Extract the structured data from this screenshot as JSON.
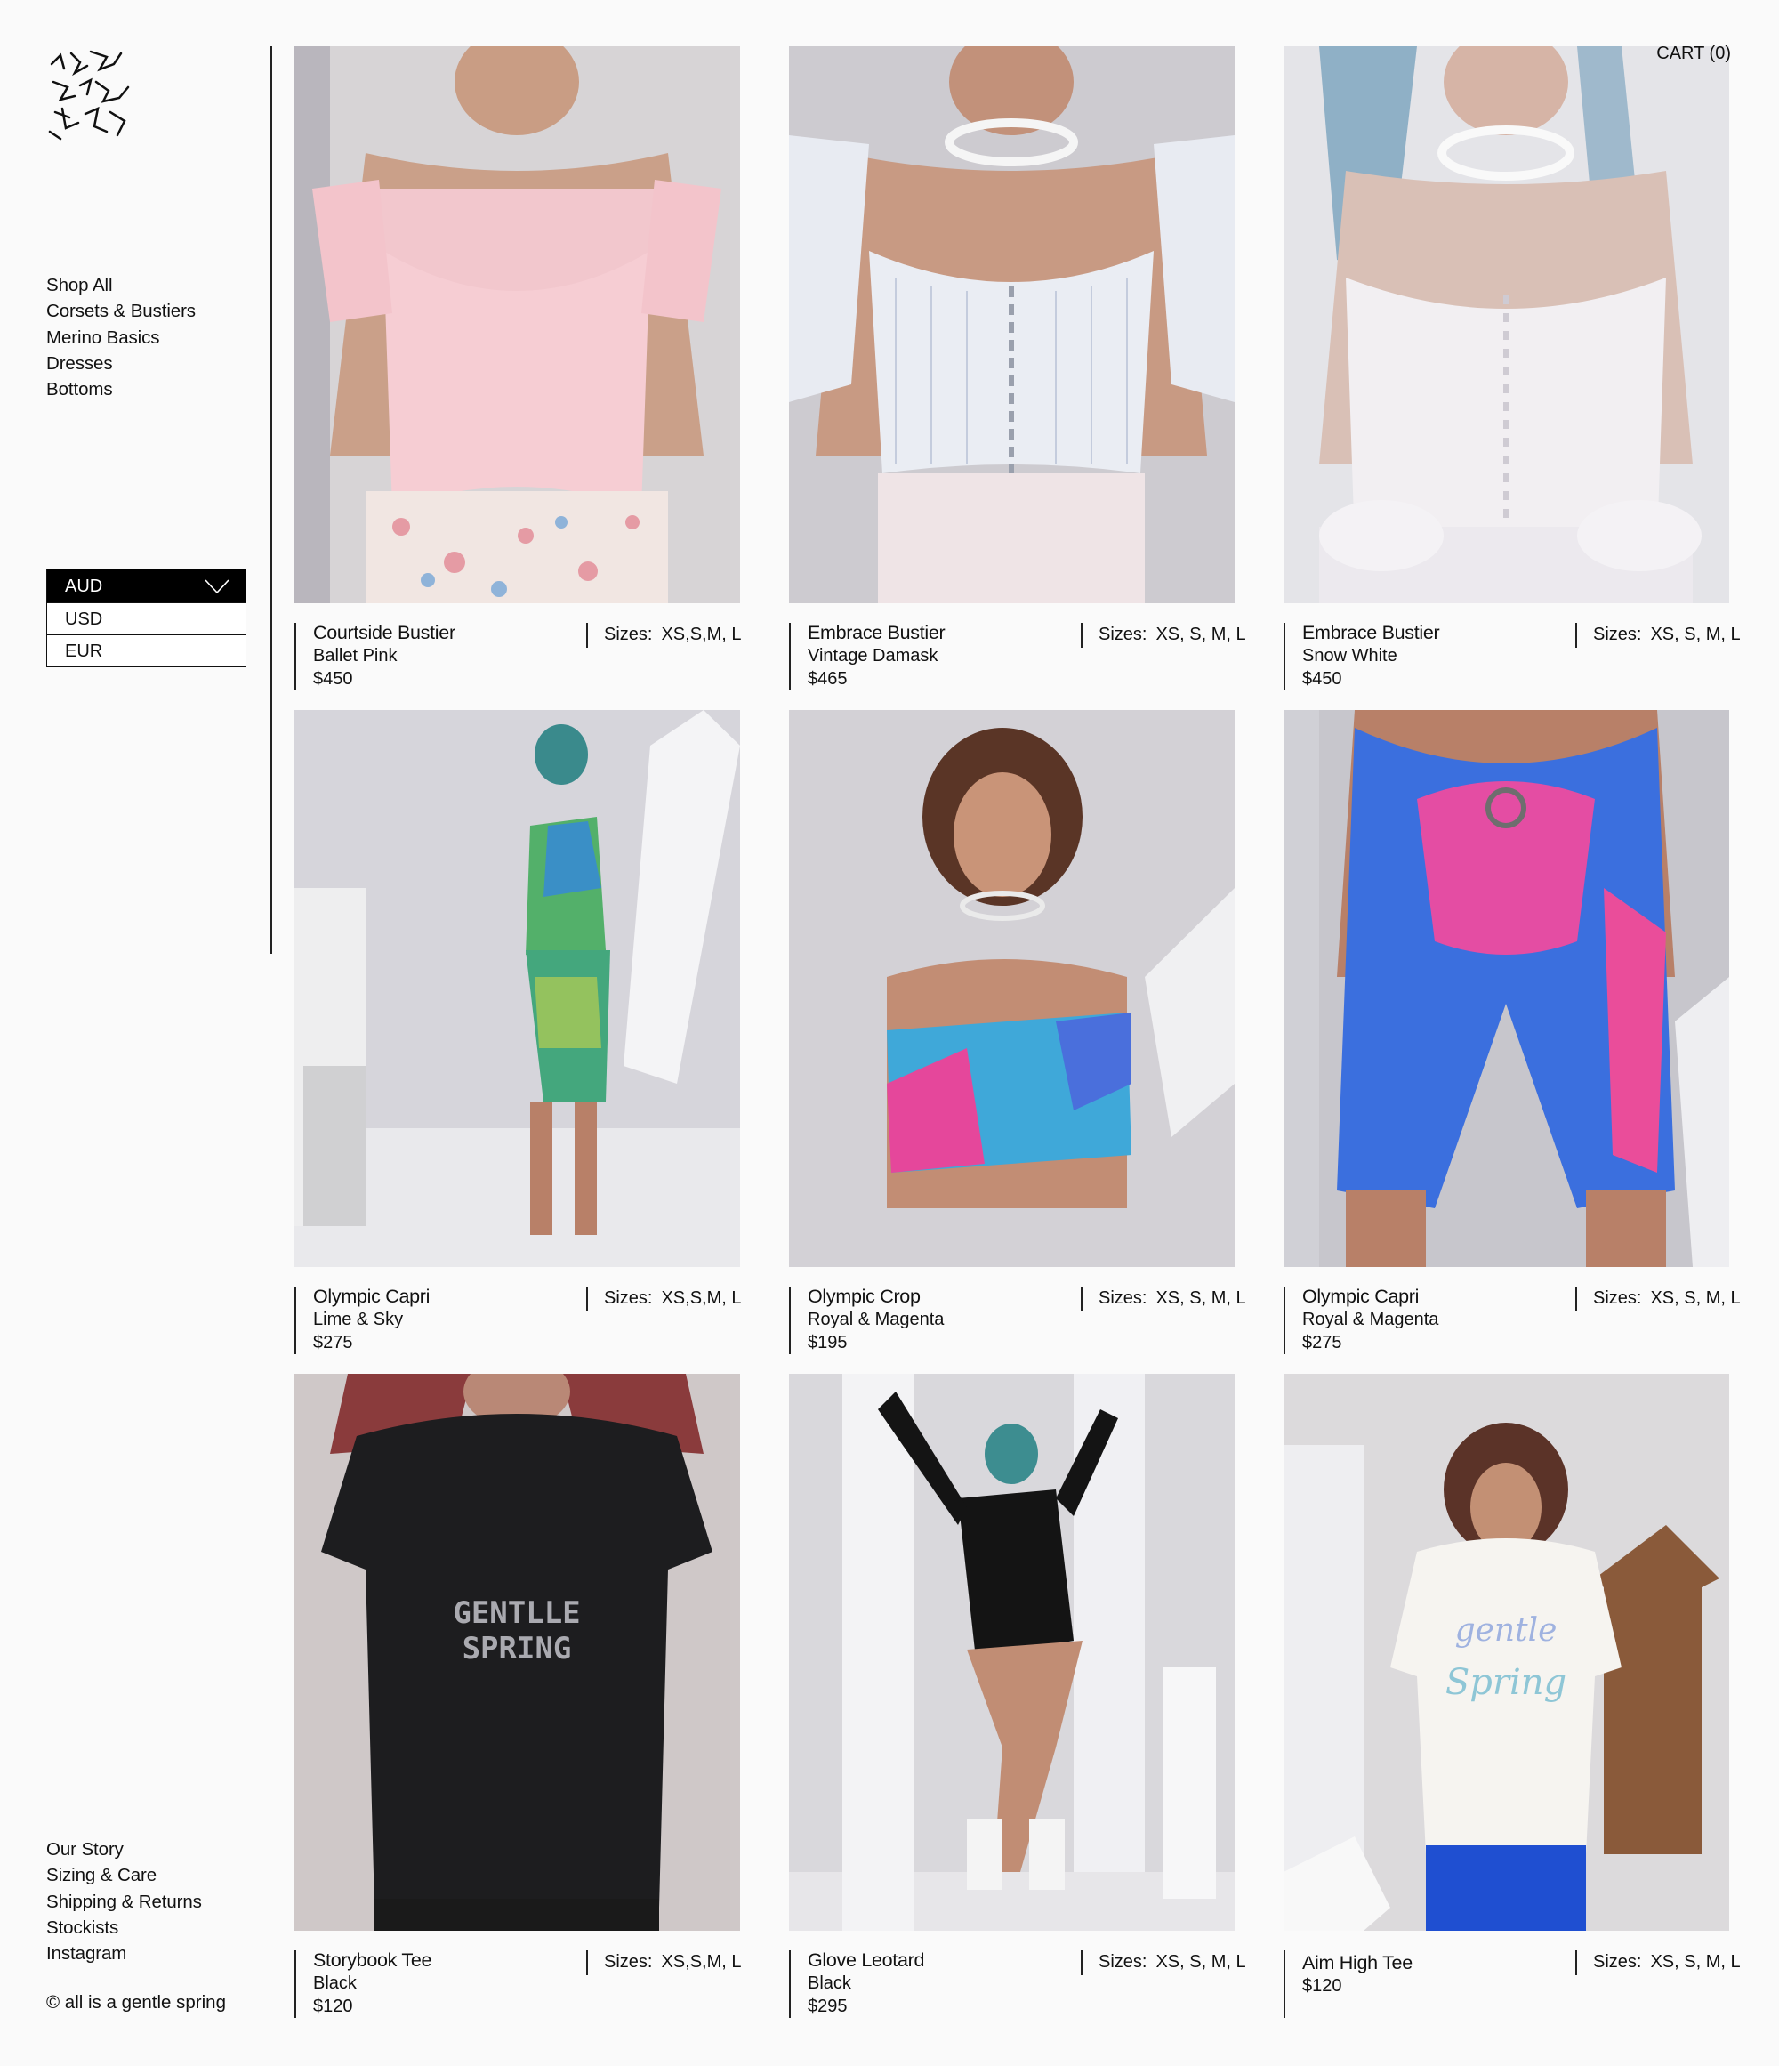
{
  "cart_label": "CART (0)",
  "nav": [
    "Shop All",
    "Corsets & Bustiers",
    "Merino Basics",
    "Dresses",
    "Bottoms"
  ],
  "currency": {
    "selected": "AUD",
    "options": [
      "USD",
      "EUR"
    ]
  },
  "footer_nav": [
    "Our Story",
    "Sizing & Care",
    "Shipping & Returns",
    "Stockists",
    "Instagram"
  ],
  "copyright": "© all is a gentle spring",
  "products": [
    {
      "name": "Courtside Bustier",
      "color": "Ballet Pink",
      "price": "$450",
      "sizes_label": "Sizes:",
      "sizes": "XS,S,M, L"
    },
    {
      "name": "Embrace Bustier",
      "color": "Vintage Damask",
      "price": "$465",
      "sizes_label": "Sizes:",
      "sizes": "XS, S, M, L"
    },
    {
      "name": "Embrace Bustier",
      "color": "Snow White",
      "price": "$450",
      "sizes_label": "Sizes:",
      "sizes": "XS, S, M, L"
    },
    {
      "name": "Olympic Capri",
      "color": "Lime & Sky",
      "price": "$275",
      "sizes_label": "Sizes:",
      "sizes": "XS,S,M, L"
    },
    {
      "name": "Olympic Crop",
      "color": "Royal & Magenta",
      "price": "$195",
      "sizes_label": "Sizes:",
      "sizes": "XS, S, M, L"
    },
    {
      "name": "Olympic Capri",
      "color": "Royal & Magenta",
      "price": "$275",
      "sizes_label": "Sizes:",
      "sizes": "XS, S, M, L"
    },
    {
      "name": "Storybook Tee",
      "color": "Black",
      "price": "$120",
      "sizes_label": "Sizes:",
      "sizes": "XS,S,M, L"
    },
    {
      "name": "Glove Leotard",
      "color": "Black",
      "price": "$295",
      "sizes_label": "Sizes:",
      "sizes": "XS, S, M, L"
    },
    {
      "name": "Aim High Tee",
      "color": "",
      "price": "$120",
      "sizes_label": "Sizes:",
      "sizes": "XS, S, M, L"
    }
  ]
}
